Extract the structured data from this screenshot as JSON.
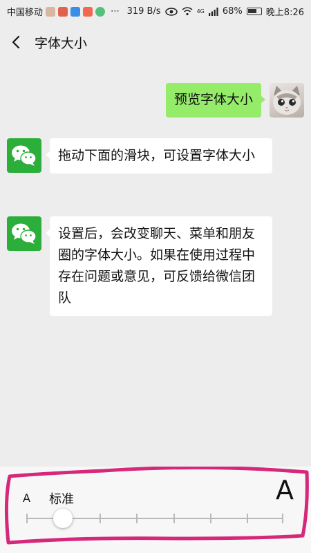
{
  "status_bar": {
    "carrier": "中国移动",
    "more_icon": "⋯",
    "network_speed": "319 B/s",
    "network_type": "4G",
    "battery_percent": "68%",
    "time": "晚上8:26"
  },
  "header": {
    "back_icon": "chevron-left-icon",
    "title": "字体大小"
  },
  "chat": {
    "preview_message": "预览字体大小",
    "messages": [
      "拖动下面的滑块，可设置字体大小",
      "设置后，会改变聊天、菜单和朋友圈的字体大小。如果在使用过程中存在问题或意见，可反馈给微信团队"
    ]
  },
  "font_size_panel": {
    "small_label": "A",
    "level_label": "标准",
    "large_label": "A",
    "slider": {
      "tick_count": 8,
      "selected_index": 1
    }
  },
  "colors": {
    "background": "#ededed",
    "sent_bubble": "#95ec69",
    "received_bubble": "#ffffff",
    "wechat_green": "#2bae3a",
    "annotation": "#d6287a"
  }
}
